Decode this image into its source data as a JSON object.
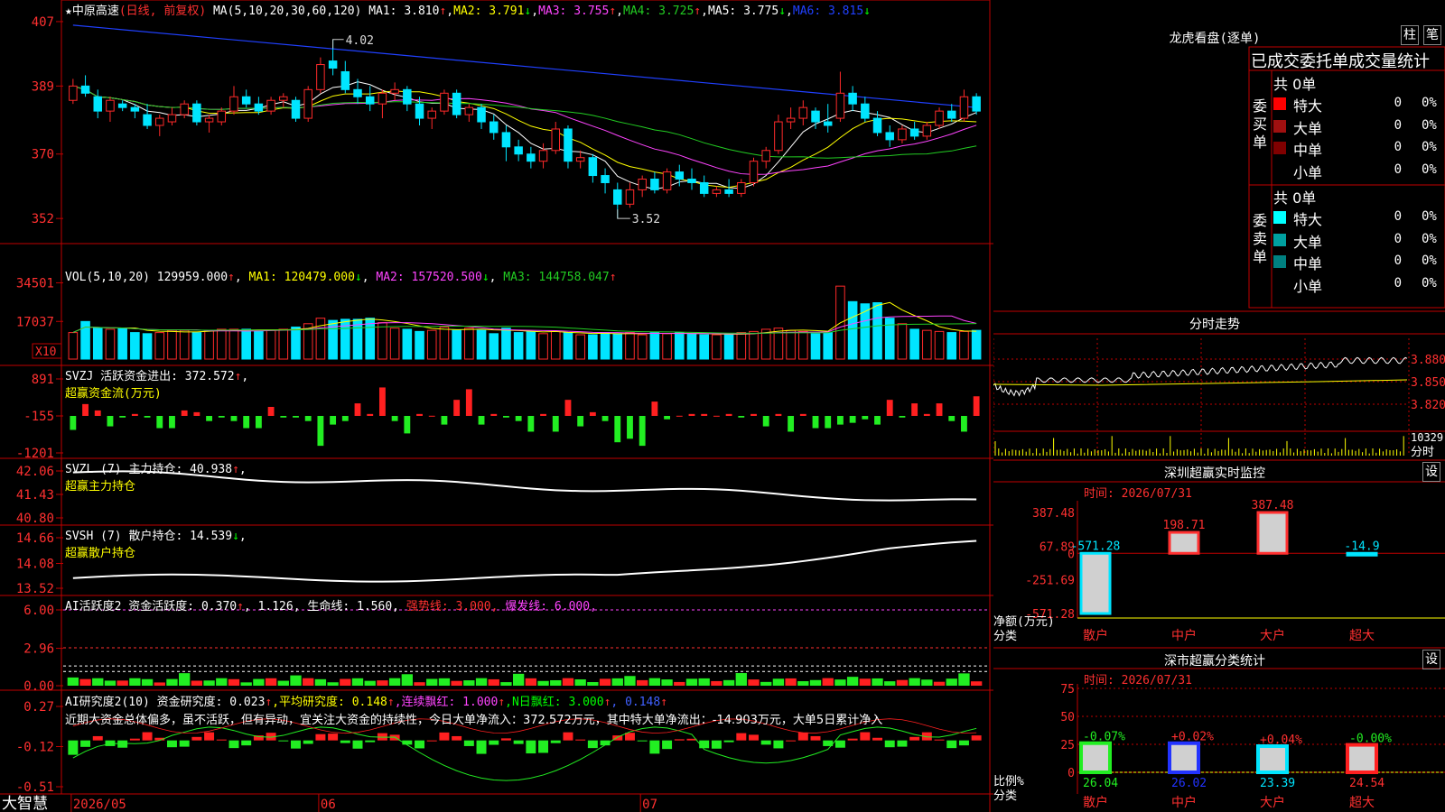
{
  "stock": {
    "name": "中原高速",
    "mode": "(日线, 前复权)"
  },
  "colors": {
    "up": "#ff2a2a",
    "down": "#00e5ff",
    "ma1": "#ffffff",
    "ma2": "#ffff00",
    "ma3": "#ff44ff",
    "ma4": "#22cc22",
    "ma5": "#ffffff",
    "ma6": "#2040ff"
  },
  "kline": {
    "ma_header": "MA(5,10,20,30,60,120)",
    "ma_values": [
      {
        "label": "MA1: 3.810",
        "arrow": "↑",
        "color": "#ffffff"
      },
      {
        "label": "MA2: 3.791",
        "arrow": "↓",
        "color": "#ffff00"
      },
      {
        "label": "MA3: 3.755",
        "arrow": "↑",
        "color": "#ff44ff"
      },
      {
        "label": "MA4: 3.725",
        "arrow": "↑",
        "color": "#22cc22"
      },
      {
        "label": "MA5: 3.775",
        "arrow": "↓",
        "color": "#ffffff"
      },
      {
        "label": "MA6: 3.815",
        "arrow": "↓",
        "color": "#2040ff"
      }
    ],
    "y_ticks": [
      "407",
      "389",
      "370",
      "352"
    ],
    "high_label": "4.02",
    "low_label": "3.52"
  },
  "vol": {
    "header": "VOL(5,10,20)",
    "value": "129959.000",
    "arrow": "↑",
    "ma1": "MA1: 120479.000",
    "ma1_arrow": "↓",
    "ma2": "MA2: 157520.500",
    "ma2_arrow": "↓",
    "ma3": "MA3: 144758.047",
    "ma3_arrow": "↑",
    "y_ticks": [
      "34501",
      "17037"
    ],
    "unit": "X10"
  },
  "svzj": {
    "header": "SVZJ  活跃资金进出: 372.572",
    "arrow": "↑",
    "sub": "超赢资金流(万元)",
    "y_ticks": [
      "891",
      "-155",
      "-1201"
    ]
  },
  "svzl": {
    "header": "SVZL (7) 主力持仓: 40.938",
    "arrow": "↑",
    "sub": "超赢主力持仓",
    "y_ticks": [
      "42.06",
      "41.43",
      "40.80"
    ]
  },
  "svsh": {
    "header": "SVSH (7) 散户持仓: 14.539",
    "arrow": "↓",
    "sub": "超赢散户持仓",
    "y_ticks": [
      "14.66",
      "14.08",
      "13.52"
    ]
  },
  "ai1": {
    "header": "AI活跃度2 资金活跃度: 0.370",
    "arrow": "↑",
    "v2": ", 1.126,",
    "v3": "生命线: 1.560,",
    "v4": "强势线: 3.000,",
    "v5": "爆发线: 6.000,",
    "y_ticks": [
      "6.00",
      "2.96",
      "0.00"
    ]
  },
  "ai2": {
    "header": "AI研究度2(10) 资金研究度: 0.023",
    "arrow": "↑",
    "v2": ",平均研究度: 0.148",
    "arrow2": "↑",
    "v3": ",连续飘红: 1.000",
    "arrow3": "↑",
    "v4": ",N日飘红: 3.000",
    "arrow4": "↑",
    "v5": ", 0.148",
    "arrow5": "↑",
    "text": "近期大资金总体偏多，虽不活跃，但有异动，宜关注大资金的持续性，今日大单净流入：372.572万元，其中特大单净流出：-14.903万元，大单5日累计净入",
    "y_ticks": [
      "0.27",
      "-0.12",
      "-0.51"
    ]
  },
  "xaxis": {
    "labels": [
      "2026/05",
      "06",
      "07"
    ],
    "brand": "大智慧"
  },
  "lhb": {
    "title": "龙虎看盘(逐单)",
    "btn1": "柱",
    "btn2": "笔",
    "subtitle": "已成交委托单成交量统计",
    "buy_label": "委买单",
    "sell_label": "委卖单",
    "buy_total": "共 0单",
    "sell_total": "共 0单",
    "buy_rows": [
      {
        "name": "特大",
        "num": "0",
        "pct": "0%",
        "color": "#ff0000"
      },
      {
        "name": "大单",
        "num": "0",
        "pct": "0%",
        "color": "#a01010"
      },
      {
        "name": "中单",
        "num": "0",
        "pct": "0%",
        "color": "#800000"
      },
      {
        "name": "小单",
        "num": "0",
        "pct": "0%",
        "color": "#000000"
      }
    ],
    "sell_rows": [
      {
        "name": "特大",
        "num": "0",
        "pct": "0%",
        "color": "#00ffff"
      },
      {
        "name": "大单",
        "num": "0",
        "pct": "0%",
        "color": "#00a0a0"
      },
      {
        "name": "中单",
        "num": "0",
        "pct": "0%",
        "color": "#008080"
      },
      {
        "name": "小单",
        "num": "0",
        "pct": "0%",
        "color": "#000000"
      }
    ]
  },
  "intraday": {
    "title": "分时走势",
    "y_ticks": [
      "3.880",
      "3.850",
      "3.820"
    ],
    "vol_tick": "10329",
    "vol_label": "分时"
  },
  "monitor": {
    "title": "深圳超赢实时监控",
    "settings": "设",
    "time": "时间: 2026/07/31",
    "y_ticks": [
      "387.48",
      "67.89",
      "0",
      "-251.69",
      "-571.28"
    ],
    "ylabel1": "净额(万元)",
    "ylabel2": "分类",
    "categories": [
      "散户",
      "中户",
      "大户",
      "超大"
    ],
    "values": [
      -571.28,
      198.71,
      387.48,
      -14.9
    ],
    "value_labels": [
      "-571.28",
      "198.71",
      "387.48",
      "-14.9"
    ]
  },
  "classify": {
    "title": "深市超赢分类统计",
    "settings": "设",
    "time": "时间: 2026/07/31",
    "y_ticks": [
      "75",
      "50",
      "25",
      "0"
    ],
    "ylabel1": "比例%",
    "ylabel2": "分类",
    "categories": [
      "散户",
      "中户",
      "大户",
      "超大"
    ],
    "values": [
      26.04,
      26.02,
      23.39,
      24.54
    ],
    "changes": [
      "-0.07%",
      "+0.02%",
      "+0.04%",
      "-0.00%"
    ]
  },
  "chart_data": [
    {
      "type": "candlestick",
      "title": "中原高速(日线, 前复权)",
      "x_labels": [
        "2026/05",
        "06",
        "07"
      ],
      "ylim": [
        3.47,
        4.09
      ],
      "y_ticks": [
        4.07,
        3.89,
        3.7,
        3.52
      ],
      "ohlc": [
        [
          3.85,
          3.91,
          3.84,
          3.89
        ],
        [
          3.89,
          3.92,
          3.86,
          3.87
        ],
        [
          3.86,
          3.88,
          3.8,
          3.82
        ],
        [
          3.82,
          3.86,
          3.79,
          3.85
        ],
        [
          3.84,
          3.85,
          3.82,
          3.83
        ],
        [
          3.83,
          3.84,
          3.8,
          3.82
        ],
        [
          3.81,
          3.84,
          3.77,
          3.78
        ],
        [
          3.78,
          3.81,
          3.75,
          3.8
        ],
        [
          3.79,
          3.83,
          3.78,
          3.81
        ],
        [
          3.81,
          3.85,
          3.8,
          3.84
        ],
        [
          3.84,
          3.85,
          3.78,
          3.79
        ],
        [
          3.79,
          3.81,
          3.76,
          3.8
        ],
        [
          3.79,
          3.83,
          3.78,
          3.82
        ],
        [
          3.82,
          3.89,
          3.81,
          3.86
        ],
        [
          3.86,
          3.88,
          3.83,
          3.84
        ],
        [
          3.84,
          3.86,
          3.81,
          3.82
        ],
        [
          3.82,
          3.86,
          3.81,
          3.85
        ],
        [
          3.85,
          3.87,
          3.83,
          3.86
        ],
        [
          3.85,
          3.86,
          3.79,
          3.8
        ],
        [
          3.8,
          3.89,
          3.79,
          3.88
        ],
        [
          3.88,
          3.97,
          3.87,
          3.95
        ],
        [
          3.96,
          4.02,
          3.92,
          3.94
        ],
        [
          3.93,
          3.96,
          3.87,
          3.88
        ],
        [
          3.88,
          3.91,
          3.84,
          3.86
        ],
        [
          3.86,
          3.89,
          3.82,
          3.84
        ],
        [
          3.84,
          3.88,
          3.8,
          3.87
        ],
        [
          3.87,
          3.9,
          3.85,
          3.88
        ],
        [
          3.88,
          3.89,
          3.82,
          3.84
        ],
        [
          3.84,
          3.86,
          3.78,
          3.8
        ],
        [
          3.8,
          3.83,
          3.77,
          3.82
        ],
        [
          3.82,
          3.88,
          3.81,
          3.87
        ],
        [
          3.87,
          3.88,
          3.8,
          3.81
        ],
        [
          3.81,
          3.84,
          3.79,
          3.83
        ],
        [
          3.83,
          3.84,
          3.77,
          3.79
        ],
        [
          3.79,
          3.81,
          3.74,
          3.76
        ],
        [
          3.76,
          3.78,
          3.68,
          3.72
        ],
        [
          3.72,
          3.74,
          3.68,
          3.7
        ],
        [
          3.7,
          3.72,
          3.66,
          3.68
        ],
        [
          3.68,
          3.73,
          3.66,
          3.71
        ],
        [
          3.71,
          3.79,
          3.7,
          3.77
        ],
        [
          3.77,
          3.78,
          3.66,
          3.68
        ],
        [
          3.68,
          3.71,
          3.66,
          3.69
        ],
        [
          3.69,
          3.7,
          3.62,
          3.64
        ],
        [
          3.64,
          3.66,
          3.59,
          3.62
        ],
        [
          3.6,
          3.62,
          3.52,
          3.56
        ],
        [
          3.56,
          3.62,
          3.55,
          3.6
        ],
        [
          3.6,
          3.64,
          3.58,
          3.63
        ],
        [
          3.63,
          3.65,
          3.59,
          3.6
        ],
        [
          3.6,
          3.66,
          3.59,
          3.65
        ],
        [
          3.65,
          3.67,
          3.61,
          3.63
        ],
        [
          3.63,
          3.66,
          3.6,
          3.62
        ],
        [
          3.62,
          3.64,
          3.58,
          3.59
        ],
        [
          3.59,
          3.61,
          3.58,
          3.6
        ],
        [
          3.6,
          3.63,
          3.58,
          3.59
        ],
        [
          3.59,
          3.63,
          3.58,
          3.62
        ],
        [
          3.62,
          3.69,
          3.61,
          3.68
        ],
        [
          3.68,
          3.72,
          3.66,
          3.71
        ],
        [
          3.71,
          3.81,
          3.7,
          3.79
        ],
        [
          3.79,
          3.83,
          3.77,
          3.8
        ],
        [
          3.8,
          3.85,
          3.78,
          3.83
        ],
        [
          3.82,
          3.83,
          3.77,
          3.79
        ],
        [
          3.79,
          3.84,
          3.76,
          3.78
        ],
        [
          3.8,
          3.93,
          3.79,
          3.87
        ],
        [
          3.87,
          3.89,
          3.82,
          3.84
        ],
        [
          3.84,
          3.86,
          3.79,
          3.8
        ],
        [
          3.8,
          3.82,
          3.75,
          3.76
        ],
        [
          3.76,
          3.78,
          3.72,
          3.74
        ],
        [
          3.74,
          3.78,
          3.73,
          3.77
        ],
        [
          3.77,
          3.79,
          3.74,
          3.75
        ],
        [
          3.75,
          3.79,
          3.74,
          3.78
        ],
        [
          3.78,
          3.83,
          3.77,
          3.82
        ],
        [
          3.82,
          3.84,
          3.79,
          3.8
        ],
        [
          3.8,
          3.88,
          3.79,
          3.86
        ],
        [
          3.86,
          3.87,
          3.81,
          3.82
        ]
      ],
      "series": [
        {
          "name": "MA1",
          "last": 3.81
        },
        {
          "name": "MA2",
          "last": 3.791
        },
        {
          "name": "MA3",
          "last": 3.755
        },
        {
          "name": "MA4",
          "last": 3.725
        },
        {
          "name": "MA5",
          "last": 3.775
        },
        {
          "name": "MA6",
          "last": 3.815
        }
      ]
    },
    {
      "type": "bar",
      "title": "VOL(5,10,20)",
      "ylim": [
        0,
        40000
      ],
      "y_ticks": [
        34501,
        17037
      ],
      "values": [
        12000,
        17000,
        14000,
        13500,
        14000,
        12000,
        11500,
        12000,
        13000,
        13000,
        12000,
        13000,
        13500,
        13500,
        13500,
        12500,
        13000,
        13500,
        14500,
        16000,
        18500,
        17500,
        18000,
        18000,
        18500,
        16500,
        14000,
        13500,
        12500,
        13000,
        14500,
        13000,
        14000,
        13000,
        11500,
        14000,
        12000,
        12500,
        11500,
        12500,
        12000,
        11000,
        11000,
        12000,
        11500,
        12000,
        11000,
        12000,
        11500,
        12000,
        11500,
        11000,
        11000,
        11000,
        12000,
        12500,
        13500,
        14000,
        13000,
        12500,
        11500,
        12000,
        33000,
        26000,
        25000,
        25500,
        18500,
        16000,
        13500,
        13000,
        12500,
        12000,
        12500,
        13000
      ]
    },
    {
      "type": "bar",
      "title": "SVZJ 活跃资金进出",
      "ylim": [
        -1201,
        891
      ],
      "values": [
        -550,
        180,
        0,
        -450,
        -200,
        -100,
        -200,
        -500,
        -500,
        0,
        -50,
        -300,
        -200,
        -300,
        -500,
        -500,
        100,
        -200,
        -200,
        -300,
        -1000,
        -400,
        -300,
        200,
        -100,
        650,
        -300,
        -650,
        -100,
        -150,
        -400,
        300,
        600,
        -400,
        -100,
        -200,
        -300,
        -600,
        -100,
        -600,
        300,
        -450,
        -50,
        -300,
        -900,
        -800,
        -1000,
        250,
        -250,
        -150,
        -100,
        -100,
        -150,
        -100,
        -200,
        -100,
        -450,
        -100,
        -600,
        -100,
        -500,
        -500,
        -400,
        -350,
        -250,
        -400,
        300,
        -200,
        200,
        -100,
        200,
        -300,
        -600,
        400
      ]
    },
    {
      "type": "line",
      "title": "SVZL 主力持仓",
      "ylim": [
        40.8,
        42.06
      ],
      "last": 40.938
    },
    {
      "type": "line",
      "title": "SVSH 散户持仓",
      "ylim": [
        13.52,
        14.66
      ],
      "last": 14.539
    },
    {
      "type": "bar",
      "title": "AI活跃度2",
      "ylim": [
        0,
        6.0
      ],
      "last": 0.37
    },
    {
      "type": "bar",
      "title": "AI研究度2(10)",
      "ylim": [
        -0.51,
        0.27
      ],
      "last": 0.023
    },
    {
      "type": "bar",
      "title": "深圳超赢实时监控",
      "categories": [
        "散户",
        "中户",
        "大户",
        "超大"
      ],
      "values": [
        -571.28,
        198.71,
        387.48,
        -14.9
      ],
      "ylim": [
        -571.28,
        387.48
      ]
    },
    {
      "type": "bar",
      "title": "深市超赢分类统计",
      "categories": [
        "散户",
        "中户",
        "大户",
        "超大"
      ],
      "values": [
        26.04,
        26.02,
        23.39,
        24.54
      ],
      "ylim": [
        0,
        75
      ]
    }
  ]
}
